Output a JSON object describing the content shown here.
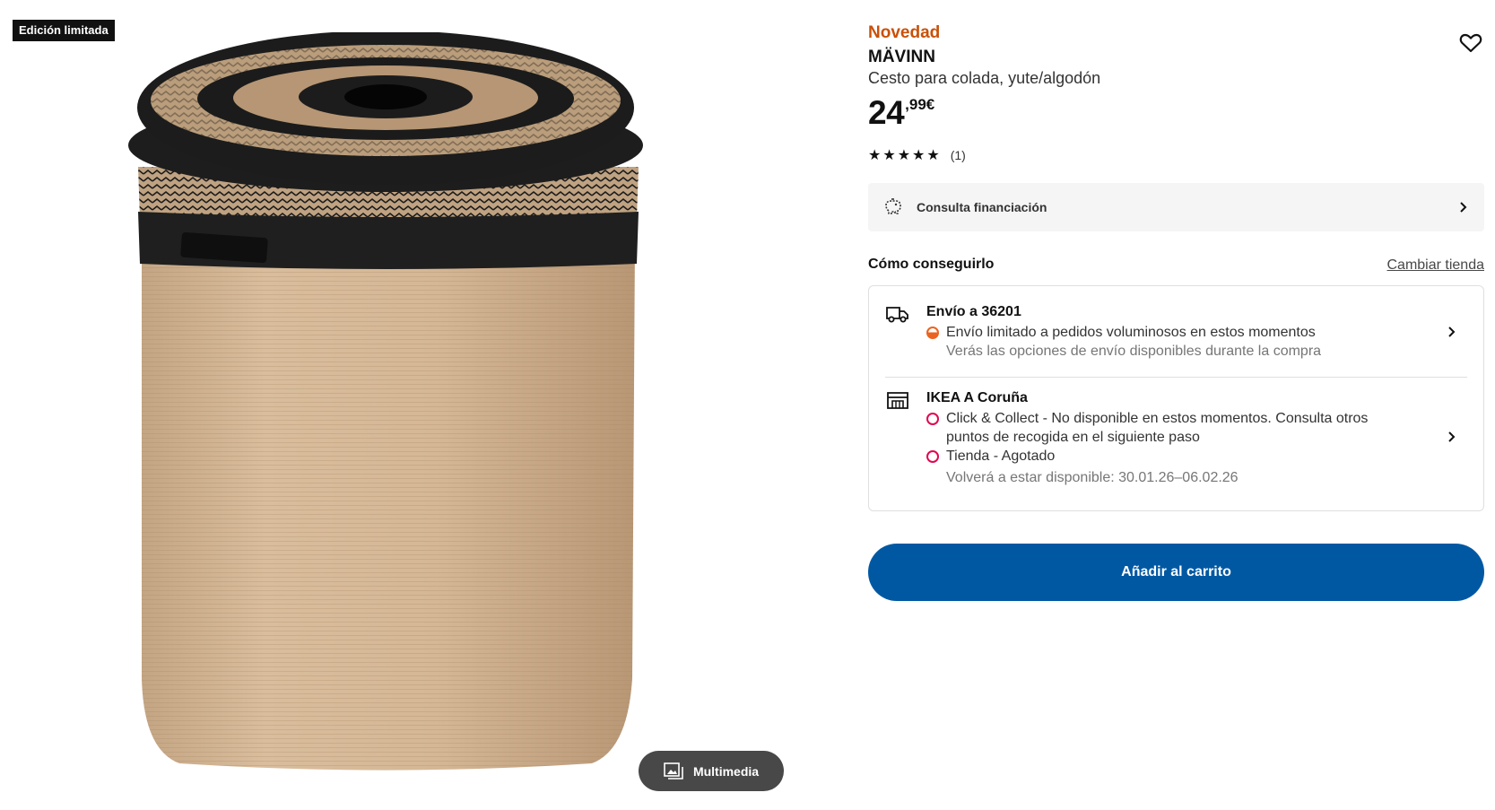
{
  "gallery": {
    "badge": "Edición limitada",
    "multimedia_label": "Multimedia",
    "multimedia_icon": "image-gallery-icon"
  },
  "product": {
    "tag": "Novedad",
    "name": "MÄVINN",
    "description": "Cesto para colada, yute/algodón",
    "price_integer": "24",
    "price_decimal": ",99€",
    "rating_stars": "★★★★★",
    "rating_count": "(1)",
    "favorite_icon": "heart-outline-icon"
  },
  "finance": {
    "label": "Consulta financiación",
    "icon": "piggy-bank-icon"
  },
  "availability": {
    "title": "Cómo conseguirlo",
    "change_store": "Cambiar tienda",
    "delivery": {
      "title": "Envío a 36201",
      "status": "Envío limitado a pedidos voluminosos en estos momentos",
      "note": "Verás las opciones de envío disponibles durante la compra",
      "icon": "truck-icon"
    },
    "store": {
      "title": "IKEA A Coruña",
      "click_collect_1": "Click & Collect - No disponible en estos momentos. Consulta otros",
      "click_collect_2": "puntos de recogida en el siguiente paso",
      "stock": "Tienda - Agotado",
      "restock": "Volverá a estar disponible: 30.01.26–06.02.26",
      "icon": "store-icon"
    }
  },
  "cart": {
    "label": "Añadir al carrito"
  },
  "colors": {
    "accent_blue": "#0058a3",
    "new_orange": "#ca5008",
    "limited_orange": "#ea6420",
    "unavailable_red": "#e00751"
  }
}
